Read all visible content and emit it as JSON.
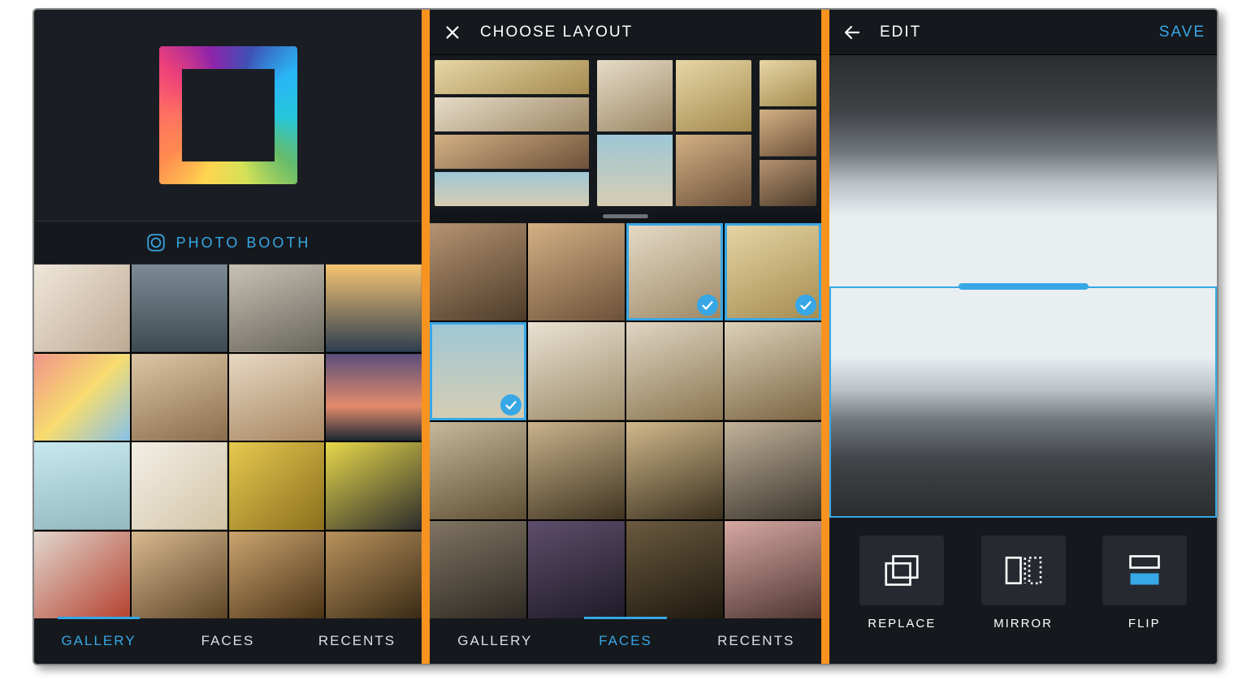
{
  "accent_color": "#37a7e6",
  "screens": {
    "panel1": {
      "photo_booth_label": "PHOTO BOOTH",
      "tabs": {
        "gallery": "GALLERY",
        "faces": "FACES",
        "recents": "RECENTS"
      },
      "active_tab": "gallery",
      "grid_items": [
        "gallery-thumb-1",
        "gallery-thumb-2",
        "gallery-thumb-3",
        "gallery-thumb-4",
        "gallery-thumb-5",
        "gallery-thumb-6",
        "gallery-thumb-7",
        "gallery-thumb-8",
        "gallery-thumb-9",
        "gallery-thumb-10",
        "gallery-thumb-11",
        "gallery-thumb-12",
        "gallery-thumb-13",
        "gallery-thumb-14",
        "gallery-thumb-15",
        "gallery-thumb-16"
      ]
    },
    "panel2": {
      "title": "CHOOSE LAYOUT",
      "layout_options": [
        "layout-4-rows",
        "layout-2x2",
        "layout-3-rows"
      ],
      "tabs": {
        "gallery": "GALLERY",
        "faces": "FACES",
        "recents": "RECENTS"
      },
      "active_tab": "faces",
      "faces": [
        {
          "id": "face-1",
          "selected": false
        },
        {
          "id": "face-2",
          "selected": false
        },
        {
          "id": "face-3",
          "selected": true
        },
        {
          "id": "face-4",
          "selected": true
        },
        {
          "id": "face-5",
          "selected": true
        },
        {
          "id": "face-6",
          "selected": false
        },
        {
          "id": "face-7",
          "selected": false
        },
        {
          "id": "face-8",
          "selected": false
        },
        {
          "id": "face-9",
          "selected": false
        },
        {
          "id": "face-10",
          "selected": false
        },
        {
          "id": "face-11",
          "selected": false
        },
        {
          "id": "face-12",
          "selected": false
        },
        {
          "id": "face-13",
          "selected": false
        },
        {
          "id": "face-14",
          "selected": false
        },
        {
          "id": "face-15",
          "selected": false
        },
        {
          "id": "face-16",
          "selected": false
        }
      ]
    },
    "panel3": {
      "title": "EDIT",
      "save_label": "SAVE",
      "selected_half": "bottom",
      "tools": {
        "replace": "REPLACE",
        "mirror": "MIRROR",
        "flip": "FLIP"
      }
    }
  }
}
